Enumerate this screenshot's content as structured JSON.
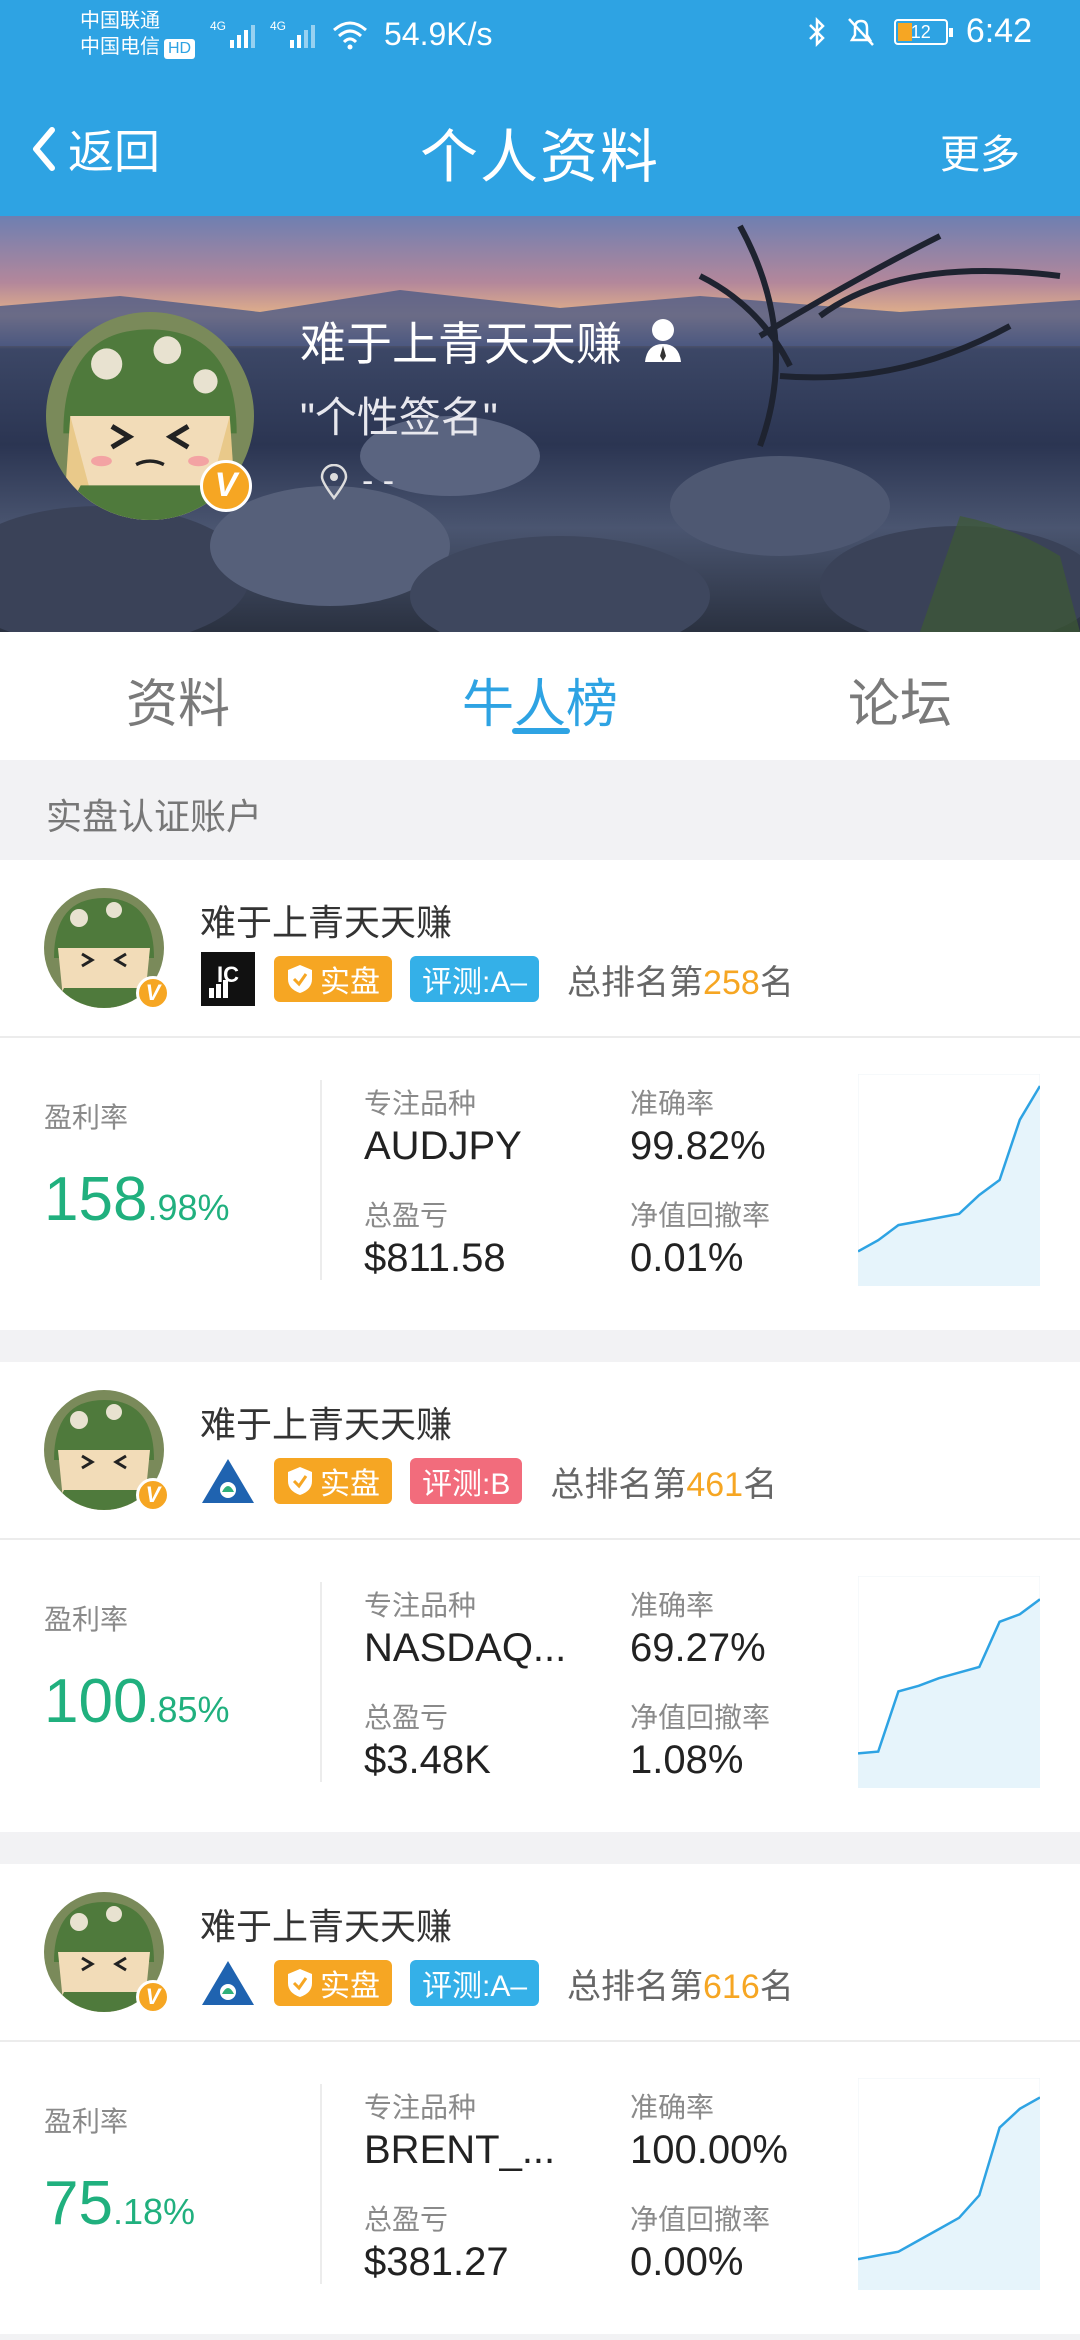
{
  "status_bar": {
    "carrier1": "中国联通",
    "carrier2": "中国电信",
    "hd": "HD",
    "net1": "4G",
    "net2": "4G",
    "speed": "54.9K/s",
    "battery": "12",
    "time": "6:42"
  },
  "nav": {
    "back_label": "返回",
    "title": "个人资料",
    "more_label": "更多"
  },
  "profile": {
    "name": "难于上青天天赚",
    "signature": "\"个性签名\"",
    "location": "- -"
  },
  "tabs": [
    {
      "label": "资料"
    },
    {
      "label": "牛人榜"
    },
    {
      "label": "论坛"
    }
  ],
  "section_title": "实盘认证账户",
  "labels": {
    "profit_rate": "盈利率",
    "focus": "专注品种",
    "accuracy": "准确率",
    "total_pl": "总盈亏",
    "drawdown": "净值回撤率",
    "rank_prefix": "总排名第",
    "rank_suffix": "名",
    "verified_tag": "实盘"
  },
  "accounts": [
    {
      "name": "难于上青天天赚",
      "grade": "评测:A–",
      "rank": "258",
      "profit_int": "158",
      "profit_dec": ".98%",
      "symbol": "AUDJPY",
      "accuracy": "99.82%",
      "total_pl": "$811.58",
      "drawdown": "0.01%",
      "curve": [
        0.12,
        0.18,
        0.26,
        0.28,
        0.3,
        0.32,
        0.42,
        0.5,
        0.82,
        1.0
      ]
    },
    {
      "name": "难于上青天天赚",
      "grade": "评测:B",
      "rank": "461",
      "profit_int": "100",
      "profit_dec": ".85%",
      "symbol": "NASDAQ...",
      "accuracy": "69.27%",
      "total_pl": "$3.48K",
      "drawdown": "1.08%",
      "curve": [
        0.12,
        0.13,
        0.45,
        0.48,
        0.52,
        0.55,
        0.58,
        0.82,
        0.86,
        0.94
      ]
    },
    {
      "name": "难于上青天天赚",
      "grade": "评测:A–",
      "rank": "616",
      "profit_int": "75",
      "profit_dec": ".18%",
      "symbol": "BRENT_...",
      "accuracy": "100.00%",
      "total_pl": "$381.27",
      "drawdown": "0.00%",
      "curve": [
        0.1,
        0.12,
        0.14,
        0.2,
        0.26,
        0.32,
        0.44,
        0.8,
        0.9,
        0.96
      ]
    }
  ],
  "colors": {
    "brand_blue": "#2ea3e3",
    "profit_green": "#20b07e",
    "gold": "#f6a623",
    "grade_a": "#34b0e8",
    "grade_b": "#f26c7c"
  },
  "icons": {
    "back": "chevron-left-icon",
    "verified": "v-badge-icon",
    "user": "user-icon",
    "location": "location-pin-icon",
    "shield": "shield-check-icon"
  }
}
